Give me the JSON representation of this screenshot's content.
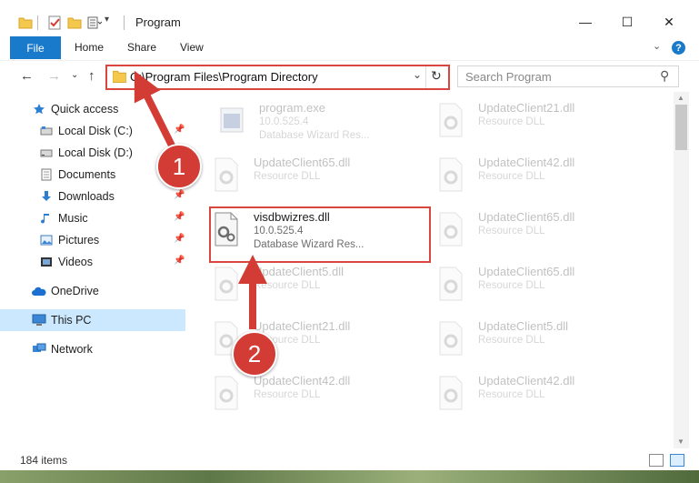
{
  "window": {
    "title": "Program",
    "controls": {
      "minimize": "—",
      "maximize": "☐",
      "close": "✕"
    }
  },
  "ribbon": {
    "tabs": [
      "File",
      "Home",
      "Share",
      "View"
    ],
    "help": "?",
    "collapse": "⌄"
  },
  "nav": {
    "back": "←",
    "forward": "→",
    "recent": "⌄",
    "up": "↑",
    "address": "C:\\Program Files\\Program Directory",
    "address_dropdown": "⌄",
    "refresh": "↻",
    "search_placeholder": "Search Program",
    "search_icon": "⚲"
  },
  "sidebar": {
    "items": [
      {
        "label": "Quick access",
        "icon": "star-icon"
      },
      {
        "label": "Local Disk (C:)",
        "icon": "drive-icon",
        "pinned": true
      },
      {
        "label": "Local Disk (D:)",
        "icon": "drive-icon"
      },
      {
        "label": "Documents",
        "icon": "documents-icon"
      },
      {
        "label": "Downloads",
        "icon": "downloads-icon",
        "pinned": true
      },
      {
        "label": "Music",
        "icon": "music-icon",
        "pinned": true
      },
      {
        "label": "Pictures",
        "icon": "pictures-icon",
        "pinned": true
      },
      {
        "label": "Videos",
        "icon": "videos-icon",
        "pinned": true
      },
      {
        "label": "OneDrive",
        "icon": "onedrive-icon"
      },
      {
        "label": "This PC",
        "icon": "this-pc-icon",
        "selected": true
      },
      {
        "label": "Network",
        "icon": "network-icon"
      }
    ],
    "pin_glyph": "📌"
  },
  "files": {
    "left": [
      {
        "name": "program.exe",
        "line2": "10.0.525.4",
        "line3": "Database Wizard Res..."
      },
      {
        "name": "UpdateClient65.dll",
        "line2": "Resource DLL"
      },
      {
        "name": "visdbwizres.dll",
        "line2": "10.0.525.4",
        "line3": "Database Wizard Res...",
        "highlighted": true
      },
      {
        "name": "UpdateClient5.dll",
        "line2": "Resource DLL"
      },
      {
        "name": "UpdateClient21.dll",
        "line2": "Resource DLL"
      },
      {
        "name": "UpdateClient42.dll",
        "line2": "Resource DLL"
      }
    ],
    "right": [
      {
        "name": "UpdateClient21.dll",
        "line2": "Resource DLL"
      },
      {
        "name": "UpdateClient42.dll",
        "line2": "Resource DLL"
      },
      {
        "name": "UpdateClient65.dll",
        "line2": "Resource DLL"
      },
      {
        "name": "UpdateClient65.dll",
        "line2": "Resource DLL"
      },
      {
        "name": "UpdateClient5.dll",
        "line2": "Resource DLL"
      },
      {
        "name": "UpdateClient42.dll",
        "line2": "Resource DLL"
      }
    ]
  },
  "status": {
    "item_count": "184 items"
  },
  "callouts": [
    "1",
    "2"
  ],
  "colors": {
    "accent": "#1979ca",
    "callout": "#d33b35",
    "selected": "#cce8ff"
  }
}
